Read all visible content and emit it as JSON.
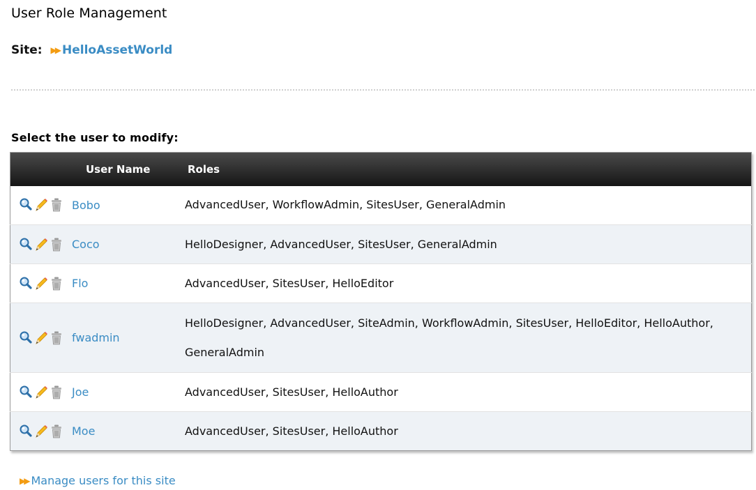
{
  "page": {
    "title": "User Role Management"
  },
  "site": {
    "label": "Site:",
    "name": "HelloAssetWorld"
  },
  "section": {
    "heading": "Select the user to modify:"
  },
  "table": {
    "headers": {
      "user_name": "User Name",
      "roles": "Roles"
    },
    "rows": [
      {
        "name": "Bobo",
        "roles": "AdvancedUser, WorkflowAdmin, SitesUser, GeneralAdmin"
      },
      {
        "name": "Coco",
        "roles": "HelloDesigner, AdvancedUser, SitesUser, GeneralAdmin"
      },
      {
        "name": "Flo",
        "roles": "AdvancedUser, SitesUser, HelloEditor"
      },
      {
        "name": "fwadmin",
        "roles": "HelloDesigner, AdvancedUser, SiteAdmin, WorkflowAdmin, SitesUser, HelloEditor, HelloAuthor, GeneralAdmin"
      },
      {
        "name": "Joe",
        "roles": "AdvancedUser, SitesUser, HelloAuthor"
      },
      {
        "name": "Moe",
        "roles": "AdvancedUser, SitesUser, HelloAuthor"
      }
    ],
    "row_icons": [
      "inspect-icon",
      "edit-icon",
      "delete-icon"
    ]
  },
  "footer": {
    "manage_link": "Manage users for this site"
  },
  "colors": {
    "link": "#3a8cc4",
    "arrow": "#f39c12",
    "header_bg": "#151515",
    "alt_row_bg": "#eef2f6"
  }
}
